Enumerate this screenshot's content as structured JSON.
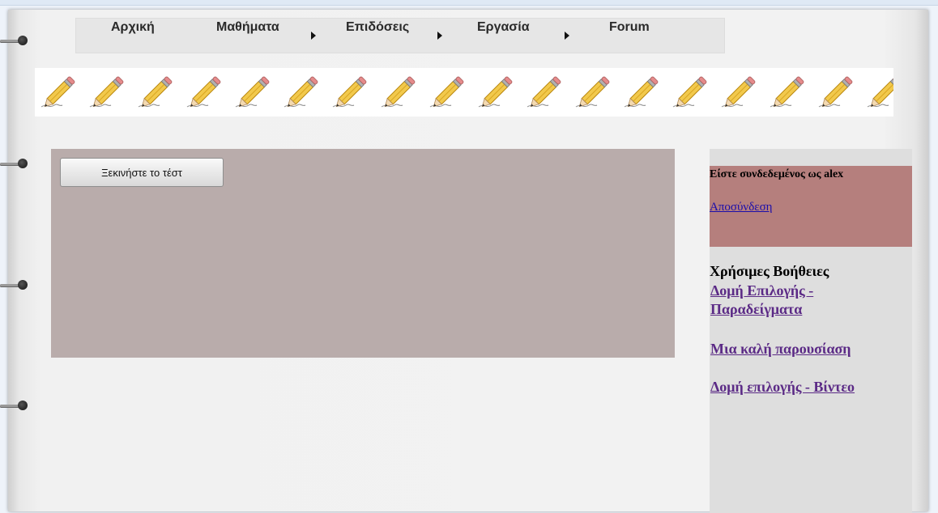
{
  "nav": {
    "items": [
      {
        "label": "Αρχική",
        "has_submenu": false
      },
      {
        "label": "Μαθήματα",
        "has_submenu": true
      },
      {
        "label": "Επιδόσεις",
        "has_submenu": true
      },
      {
        "label": "Εργασία",
        "has_submenu": true
      },
      {
        "label": "Forum",
        "has_submenu": false
      }
    ]
  },
  "banner": {
    "icon": "pencil-icon",
    "count": 18
  },
  "main": {
    "start_button": "Ξεκινήστε το τέστ"
  },
  "sidebar": {
    "login_text": "Είστε συνδεδεμένος ως alex",
    "logout_link": "Αποσύνδεση",
    "help_title": "Χρήσιμες Βοήθειες",
    "help_links": [
      "Δομή Επιλογής - Παραδείγματα",
      "Μια καλή παρουσίαση",
      "Δομή επιλογής - Βίντεο"
    ]
  },
  "colors": {
    "main_panel": "#b9acab",
    "login_box": "#b57f7d",
    "sidebar": "#dedede",
    "link": "#5b2a86"
  }
}
